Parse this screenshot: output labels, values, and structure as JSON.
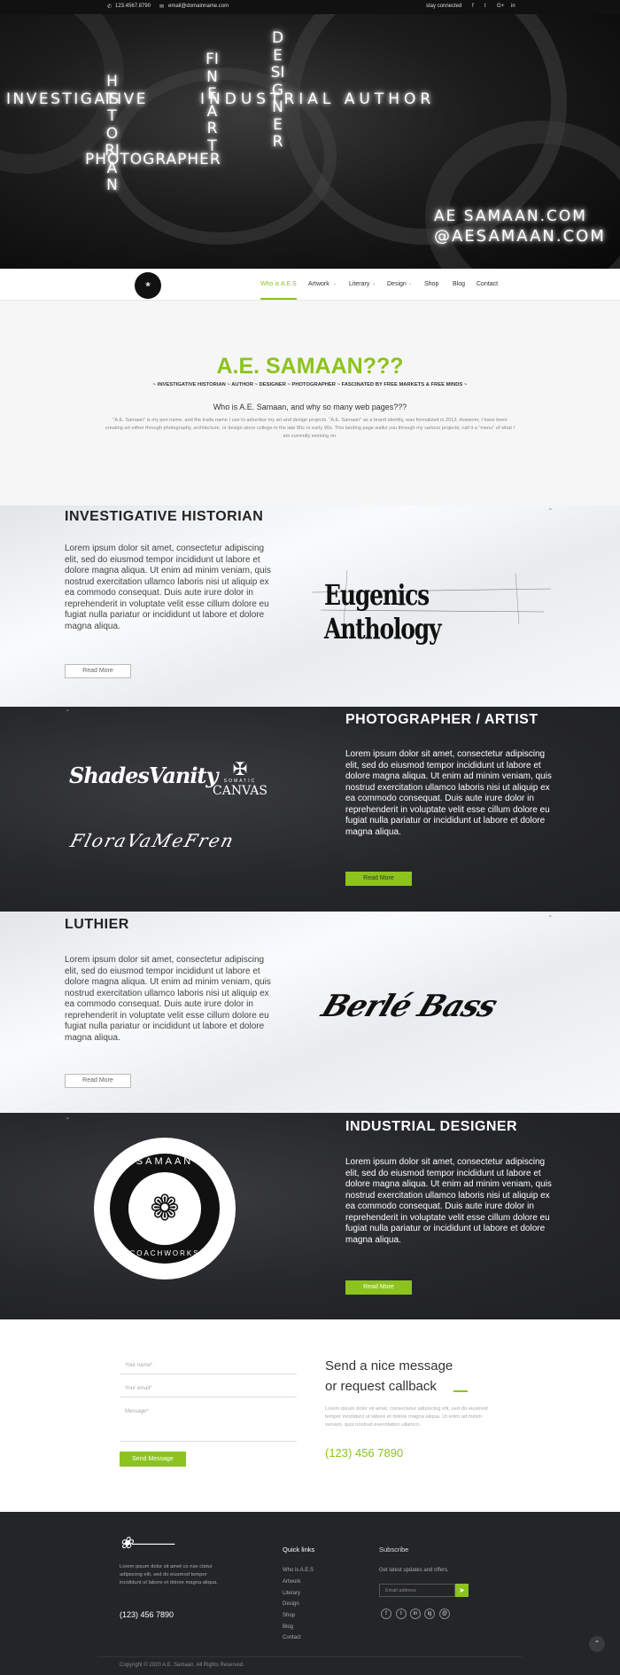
{
  "topbar": {
    "phone": "123.4567.8790",
    "email": "email@domainname.com",
    "stay": "stay connected",
    "social": [
      "f",
      "t",
      "G+",
      "in"
    ]
  },
  "hero": {
    "investigative": "INVESTIGATIVE",
    "historian": "HISTORIAN",
    "photographer": "PHOTOGRAPHER",
    "fineart": "FINEART",
    "industrial_author": "INDUSTRIAL AUTHOR",
    "designer": "DESIGNER",
    "domain_line1": "AE SAMAAN.COM",
    "domain_line2": "@AESAMAAN.COM"
  },
  "nav": {
    "items": [
      "Who is A.E.S",
      "Artwork",
      "Literary",
      "Design",
      "Shop",
      "Blog",
      "Contact"
    ]
  },
  "intro": {
    "title": "A.E. SAMAAN???",
    "tagline": "~ INVESTIGATIVE HISTORIAN ~ AUTHOR ~ DESIGNER ~ PHOTOGRAPHER ~ FASCINATED BY FREE MARKETS & FREE MINDS ~",
    "question": "Who is A.E. Samaan, and why so many web pages???",
    "paragraph": "\"A.E. Samaan\" is my pen name, and the trade name I use to advertise my art and design projects. \"A.E. Samaan\" as a brand identity, was formalized in 2013. However, I have been creating art either through photography, architecture, or design since college in the late 80s or early 90s. This landing page walks you through my various projects; call it a \"menu\" of what I am currently working on."
  },
  "sections": [
    {
      "title": "INVESTIGATIVE HISTORIAN",
      "body": "Lorem ipsum dolor sit amet, consectetur adipiscing elit, sed do eiusmod tempor incididunt ut labore et dolore magna aliqua. Ut enim ad minim veniam, quis nostrud exercitation ullamco laboris nisi ut aliquip ex ea commodo consequat. Duis aute irure dolor in reprehenderit in voluptate velit esse cillum dolore eu fugiat nulla pariatur or incididunt ut labore et dolore magna aliqua.",
      "button": "Read More",
      "logo": "Eugenics Anthology"
    },
    {
      "title": "PHOTOGRAPHER / ARTIST",
      "body": "Lorem ipsum dolor sit amet, consectetur adipiscing elit, sed do eiusmod tempor incididunt ut labore et dolore magna aliqua. Ut enim ad minim veniam, quis nostrud exercitation ullamco laboris nisi ut aliquip ex ea commodo consequat. Duis aute irure dolor in reprehenderit in voluptate velit esse cillum dolore eu fugiat nulla pariatur or incididunt ut labore et dolore magna aliqua.",
      "button": "Read More",
      "logos": [
        "ShadesVanity",
        "SOMATIC",
        "CANVAS",
        "FloraVaMeFren"
      ]
    },
    {
      "title": "LUTHIER",
      "body": "Lorem ipsum dolor sit amet, consectetur adipiscing elit, sed do eiusmod tempor incididunt ut labore et dolore magna aliqua. Ut enim ad minim veniam, quis nostrud exercitation ullamco laboris nisi ut aliquip ex ea commodo consequat. Duis aute irure dolor in reprehenderit in voluptate velit esse cillum dolore eu fugiat nulla pariatur or incididunt ut labore et dolore magna aliqua.",
      "button": "Read More",
      "logo": "Berlé Bass"
    },
    {
      "title": "INDUSTRIAL DESIGNER",
      "body": "Lorem ipsum dolor sit amet, consectetur adipiscing elit, sed do eiusmod tempor incididunt ut labore et dolore magna aliqua. Ut enim ad minim veniam, quis nostrud exercitation ullamco laboris nisi ut aliquip ex ea commodo consequat. Duis aute irure dolor in reprehenderit in voluptate velit esse cillum dolore eu fugiat nulla pariatur or incididunt ut labore et dolore magna aliqua.",
      "button": "Read More",
      "logo_top": "SAMAAN",
      "logo_bottom": "COACHWORKS"
    }
  ],
  "contact": {
    "name_placeholder": "Your name*",
    "email_placeholder": "Your email*",
    "message_placeholder": "Message*",
    "send": "Send Message",
    "heading_line1": "Send a nice message",
    "heading_line2": "or request callback",
    "text": "Lorem ipsum dolor sit amet, consectetur adipiscing elit, sed do eiusmod tempor incididunt ut labore et dolore magna aliqua. Ut enim ad minim veniam, quis nostrud exercitation ullamco.",
    "phone": "(123) 456 7890"
  },
  "footer": {
    "about": "Lorem ipsum dolor sit amet co nse ctetur adipiscing elit, sed do eiusmod tempor incididunt ut labore et dolore magna aliqua.",
    "phone": "(123) 456 7890",
    "quick_title": "Quick links",
    "links": [
      "Who is A.E.S",
      "Artwork",
      "Literary",
      "Design",
      "Shop",
      "Blog",
      "Contact"
    ],
    "subscribe_title": "Subscribe",
    "subscribe_text": "Get latest updates and offers.",
    "email_placeholder": "Email address",
    "social": [
      "f",
      "t",
      "in",
      "ig",
      "@"
    ],
    "copyright": "Copyright © 2020 A.E. Samaan. All Rights Reserved."
  },
  "colors": {
    "accent": "#8cc31f",
    "dark": "#242528"
  }
}
